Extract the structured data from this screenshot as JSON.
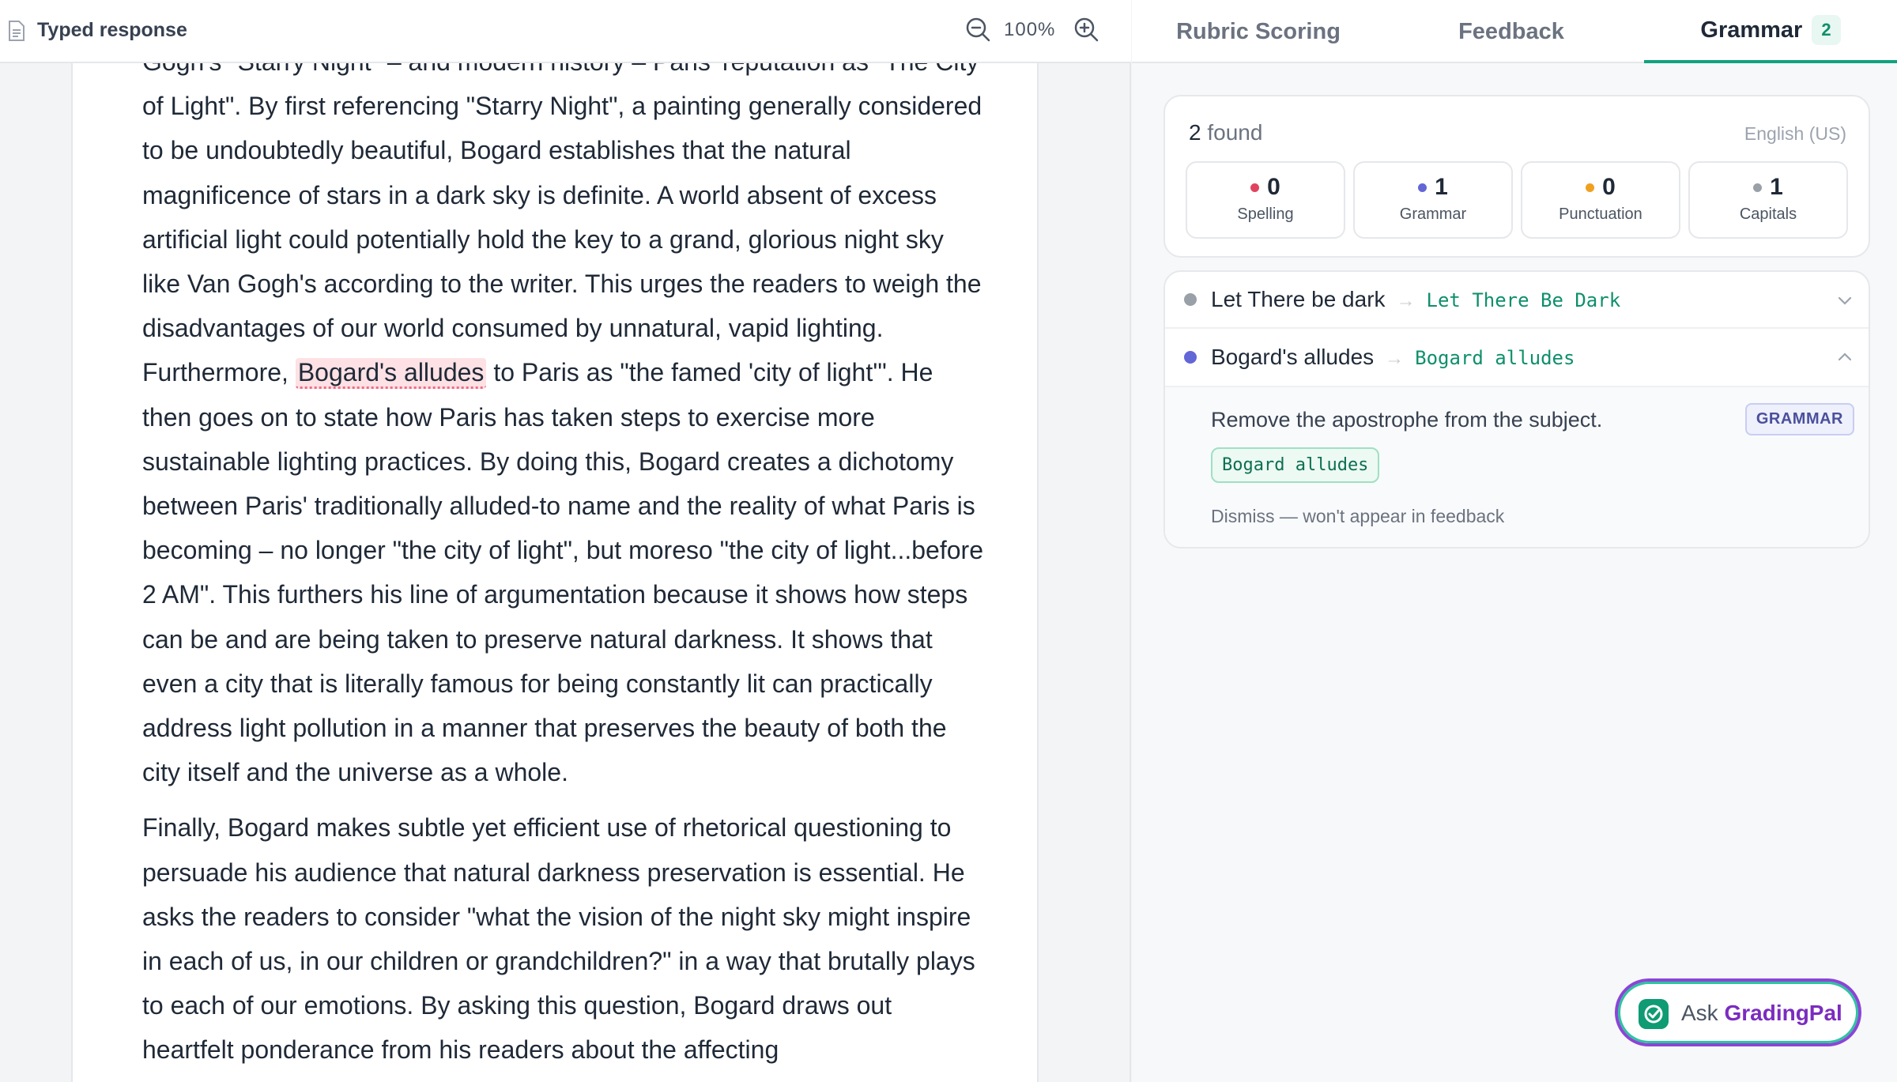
{
  "viewer": {
    "title": "Typed response",
    "zoom": "100%",
    "icons": {
      "document": "document-icon",
      "zoom_out": "zoom-out-icon",
      "zoom_in": "zoom-in-icon"
    }
  },
  "essay": {
    "p1_pre": "Gogh's \"Starry Night\" – and modern history – Paris' reputation as \"The City of Light\". By first referencing \"Starry Night\", a painting generally considered to be undoubtedly beautiful, Bogard establishes that the natural magnificence of stars in a dark sky is definite. A world absent of excess artificial light could potentially hold the key to a grand, glorious night sky like Van Gogh's according to the writer. This urges the readers to weigh the disadvantages of our world consumed by unnatural, vapid lighting. Furthermore,",
    "p1_highlight": "Bogard's alludes",
    "p1_post": "to Paris as \"the famed 'city of light'\". He then goes on to state how Paris has taken steps to exercise more sustainable lighting practices. By doing this, Bogard creates a dichotomy between Paris' traditionally alluded-to name and the reality of what Paris is becoming – no longer \"the city of light\", but moreso \"the city of light...before 2 AM\". This furthers his line of argumentation because it shows how steps can be and are being taken to preserve natural darkness. It shows that even a city that is literally famous for being constantly lit can practically address light pollution in a manner that preserves the beauty of both the city itself and the universe as a whole.",
    "p2": "Finally, Bogard makes subtle yet efficient use of rhetorical questioning to persuade his audience that natural darkness preservation is essential. He asks the readers to consider \"what the vision of the night sky might inspire in each of us, in our children or grandchildren?\" in a way that brutally plays to each of our emotions. By asking this question, Bogard draws out heartfelt ponderance from his readers about the affecting"
  },
  "tabs": [
    {
      "label": "Rubric Scoring"
    },
    {
      "label": "Feedback"
    },
    {
      "label": "Grammar",
      "badge": "2"
    }
  ],
  "summary": {
    "count": "2",
    "found_label": "found",
    "language": "English (US)",
    "stats": [
      {
        "value": "0",
        "label": "Spelling",
        "color": "#e0435f"
      },
      {
        "value": "1",
        "label": "Grammar",
        "color": "#6366d6"
      },
      {
        "value": "0",
        "label": "Punctuation",
        "color": "#f0a020"
      },
      {
        "value": "1",
        "label": "Capitals",
        "color": "#9aa0a8"
      }
    ]
  },
  "issues": [
    {
      "original": "Let There be dark",
      "arrow": "→",
      "suggestion": "Let There Be Dark",
      "dot_color": "#9aa0a8",
      "expanded": false
    },
    {
      "original": "Bogard's alludes",
      "arrow": "→",
      "suggestion": "Bogard alludes",
      "dot_color": "#6366d6",
      "expanded": true,
      "detail": {
        "message": "Remove the apostrophe from the subject.",
        "type": "GRAMMAR",
        "chip": "Bogard alludes",
        "dismiss": "Dismiss — won't appear in feedback"
      }
    }
  ],
  "assistant": {
    "prefix": "Ask",
    "brand": "GradingPal"
  },
  "colors": {
    "accent": "#10a37f",
    "highlight_bg": "#fde1e4",
    "highlight_underline": "#f26a82",
    "brand_purple": "#7b2cbf"
  }
}
